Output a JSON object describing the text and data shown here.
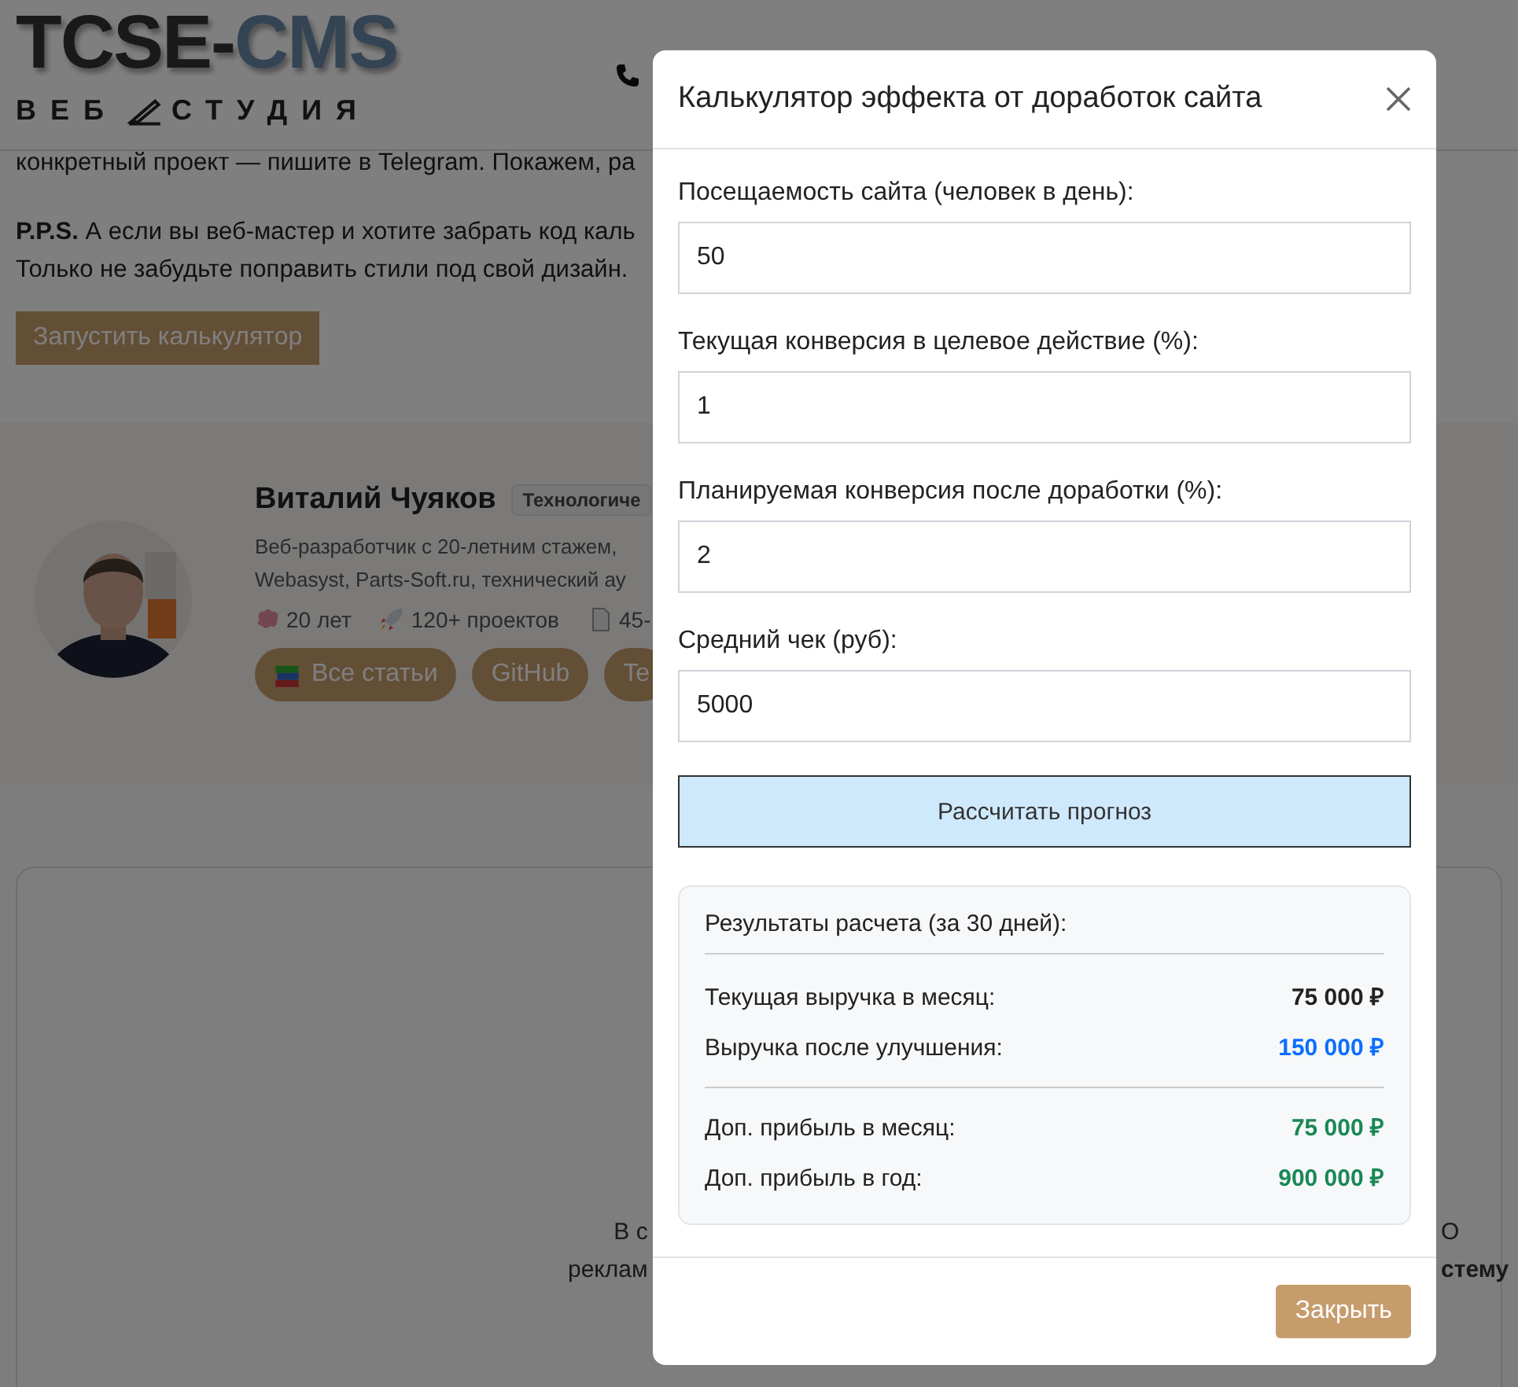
{
  "header": {
    "logo_main": "TCSE-",
    "logo_accent": "CMS",
    "logo_sub_left": "ВЕБ",
    "logo_sub_right": "СТУДИЯ"
  },
  "article": {
    "lines": [
      "конкретный проект — пишите в Telegram. Покажем, ра"
    ],
    "pps": [
      "**P.P.S.** А если вы веб-мастер и хотите забрать код каль",
      "Только не забудьте поправить стили под свой дизайн."
    ],
    "launch_button": "Запустить калькулятор"
  },
  "author": {
    "name": "Виталий Чуяков",
    "badge": "Технологиче",
    "bio": [
      "Веб-разработчик с 20-летним стажем,",
      "Webasyst, Parts-Soft.ru, технический ау"
    ],
    "stats": [
      {
        "kind": "brain",
        "text": "20 лет"
      },
      {
        "kind": "rocket",
        "text": "120+ проектов"
      },
      {
        "kind": "document",
        "text": "45-"
      }
    ],
    "links": [
      {
        "kind": "books",
        "label": "Все статьи"
      },
      {
        "kind": "plain",
        "label": "GitHub"
      },
      {
        "kind": "plain",
        "label": "Te"
      }
    ]
  },
  "card": {
    "left_lines": [
      "В с",
      "реклам"
    ],
    "right_lines": [
      "О",
      "стему"
    ]
  },
  "modal": {
    "title": "Калькулятор эффекта от доработок сайта",
    "fields": [
      {
        "label": "Посещаемость сайта (человек в день):",
        "value": "50"
      },
      {
        "label": "Текущая конверсия в целевое действие (%):",
        "value": "1"
      },
      {
        "label": "Планируемая конверсия после доработки (%):",
        "value": "2"
      },
      {
        "label": "Средний чек (руб):",
        "value": "5000"
      }
    ],
    "calc_button": "Рассчитать прогноз",
    "results": {
      "title": "Результаты расчета (за 30 дней):",
      "groups": [
        [
          {
            "label": "Текущая выручка в месяц:",
            "value": "75 000 ₽",
            "kind": "current"
          },
          {
            "label": "Выручка после улучшения:",
            "value": "150 000 ₽",
            "kind": "improved"
          }
        ],
        [
          {
            "label": "Доп. прибыль в месяц:",
            "value": "75 000 ₽",
            "kind": "profit"
          },
          {
            "label": "Доп. прибыль в год:",
            "value": "900 000 ₽",
            "kind": "profit"
          }
        ]
      ]
    },
    "close_button": "Закрыть"
  }
}
